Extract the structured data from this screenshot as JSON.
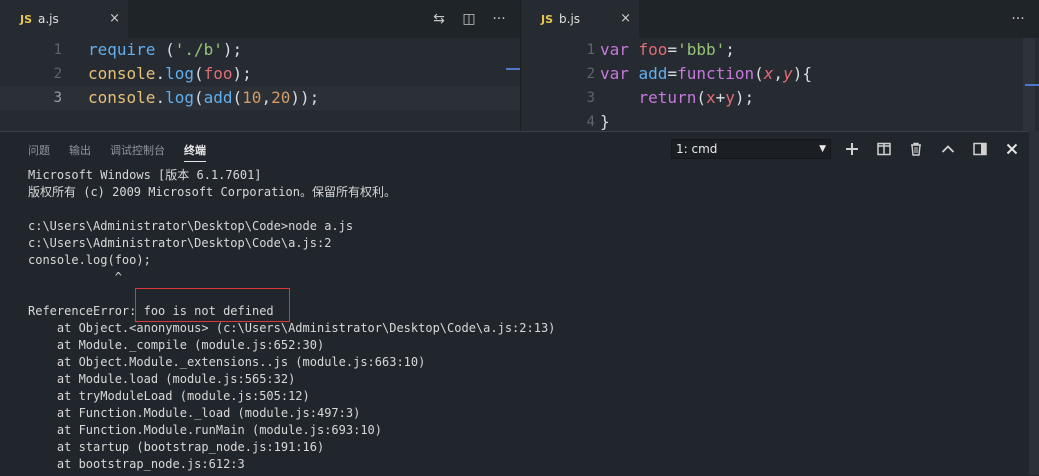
{
  "left_editor": {
    "tab": {
      "badge": "JS",
      "name": "a.js",
      "close": "×"
    },
    "actions": [
      "⇆",
      "◫",
      "···"
    ],
    "lines": [
      {
        "num": "1",
        "tokens": [
          [
            "require",
            "fn"
          ],
          [
            " (",
            "pl"
          ],
          [
            "'./b'",
            "str"
          ],
          [
            ");",
            "pl"
          ]
        ]
      },
      {
        "num": "2",
        "tokens": [
          [
            "console",
            "ty"
          ],
          [
            ".",
            "pl"
          ],
          [
            "log",
            "fn"
          ],
          [
            "(",
            "pl"
          ],
          [
            "foo",
            "id"
          ],
          [
            ");",
            "pl"
          ]
        ]
      },
      {
        "num": "3",
        "tokens": [
          [
            "console",
            "ty"
          ],
          [
            ".",
            "pl"
          ],
          [
            "log",
            "fn"
          ],
          [
            "(",
            "pl"
          ],
          [
            "add",
            "fn"
          ],
          [
            "(",
            "pl"
          ],
          [
            "10",
            "num"
          ],
          [
            ",",
            "pl"
          ],
          [
            "20",
            "num"
          ],
          [
            "));",
            "pl"
          ]
        ]
      }
    ]
  },
  "right_editor": {
    "tab": {
      "badge": "JS",
      "name": "b.js",
      "close": "×"
    },
    "actions": [
      "···"
    ],
    "lines": [
      {
        "num": "1",
        "tokens": [
          [
            "var ",
            "kw"
          ],
          [
            "foo",
            "id"
          ],
          [
            "=",
            "pl"
          ],
          [
            "'bbb'",
            "str"
          ],
          [
            ";",
            "pl"
          ]
        ]
      },
      {
        "num": "2",
        "tokens": [
          [
            "var ",
            "kw"
          ],
          [
            "add",
            "fn"
          ],
          [
            "=",
            "pl"
          ],
          [
            "function",
            "kw"
          ],
          [
            "(",
            "pl"
          ],
          [
            "x",
            "it"
          ],
          [
            ",",
            "pl"
          ],
          [
            "y",
            "it"
          ],
          [
            "){",
            "pl"
          ]
        ]
      },
      {
        "num": "3",
        "tokens": [
          [
            "    ",
            "pl"
          ],
          [
            "return",
            "kw"
          ],
          [
            "(",
            "pl"
          ],
          [
            "x",
            "id"
          ],
          [
            "+",
            "pl"
          ],
          [
            "y",
            "id"
          ],
          [
            ");",
            "pl"
          ]
        ]
      },
      {
        "num": "4",
        "tokens": [
          [
            "}",
            "pl"
          ]
        ]
      }
    ]
  },
  "panel": {
    "tabs": [
      "问题",
      "输出",
      "调试控制台",
      "终端"
    ],
    "active_tab": 3,
    "terminal_select": "1: cmd",
    "icons": [
      "plus-icon",
      "split-icon",
      "trash-icon",
      "chevron-up-icon",
      "panel-icon",
      "close-icon"
    ],
    "terminal_lines": [
      "Microsoft Windows [版本 6.1.7601]",
      "版权所有 (c) 2009 Microsoft Corporation。保留所有权利。",
      "",
      "c:\\Users\\Administrator\\Desktop\\Code>node a.js",
      "c:\\Users\\Administrator\\Desktop\\Code\\a.js:2",
      "console.log(foo);",
      "            ^",
      "",
      "ReferenceError: foo is not defined",
      "    at Object.<anonymous> (c:\\Users\\Administrator\\Desktop\\Code\\a.js:2:13)",
      "    at Module._compile (module.js:652:30)",
      "    at Object.Module._extensions..js (module.js:663:10)",
      "    at Module.load (module.js:565:32)",
      "    at tryModuleLoad (module.js:505:12)",
      "    at Function.Module._load (module.js:497:3)",
      "    at Function.Module.runMain (module.js:693:10)",
      "    at startup (bootstrap_node.js:191:16)",
      "    at bootstrap_node.js:612:3"
    ]
  }
}
